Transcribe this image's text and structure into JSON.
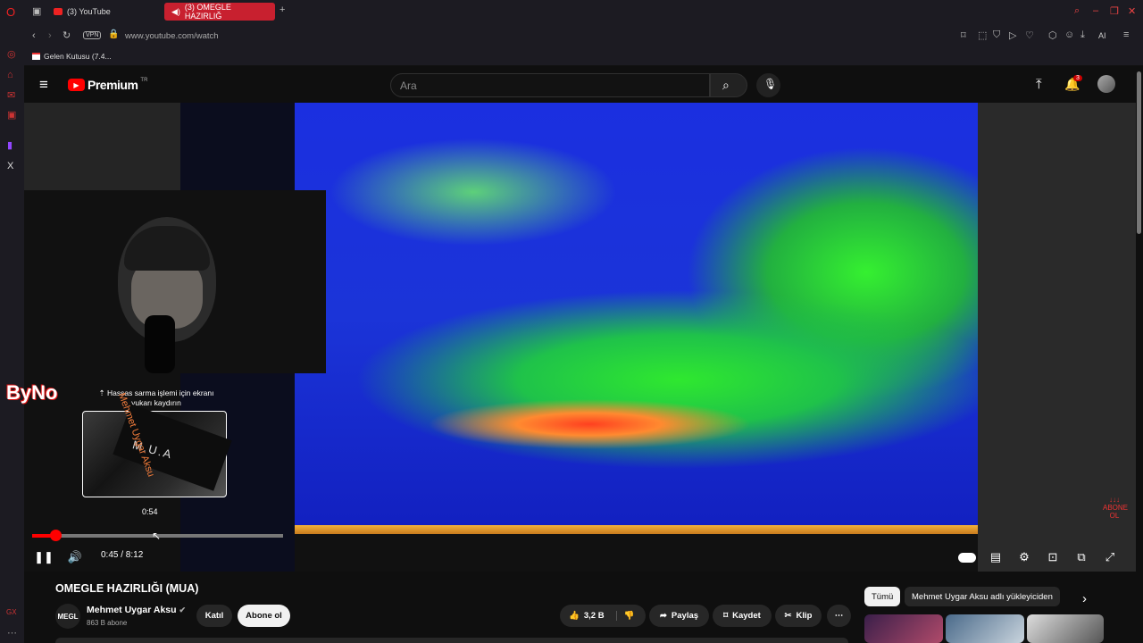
{
  "browser": {
    "tabs": [
      {
        "label": "(3) YouTube"
      },
      {
        "label": "(3) OMEGLE HAZIRLIĞ"
      }
    ],
    "vpn_label": "VPN",
    "url": "www.youtube.com/watch",
    "ai_label": "AI",
    "bookmark": "Gelen Kutusu (7.4...",
    "accent_color": "#c8202f"
  },
  "youtube": {
    "logo_text": "Premium",
    "logo_sup": "TR",
    "search_placeholder": "Ara",
    "notifications_count": "3"
  },
  "player": {
    "hint": "⇡ Hassas sarma işlemi için ekranı yukarı kaydırın",
    "preview_time": "0:54",
    "time_display": "0:45 / 8:12",
    "progress": 0.0924,
    "buffered": 0.1149,
    "preview_text": "M.U.A",
    "overlay_logo": "ByNo",
    "corner_text": "ABONE OL"
  },
  "video": {
    "title": "OMEGLE HAZIRLIĞI (MUA)",
    "channel": "Mehmet Uygar Aksu",
    "avatar_text": "MEGL",
    "subscribers": "863 B abone",
    "join_label": "Katıl",
    "subscribe_label": "Abone ol",
    "likes": "3,2 B",
    "share_label": "Paylaş",
    "save_label": "Kaydet",
    "clip_label": "Klip"
  },
  "sidebar": {
    "chips": [
      "Tümü",
      "Mehmet Uygar Aksu adlı yükleyiciden"
    ]
  }
}
